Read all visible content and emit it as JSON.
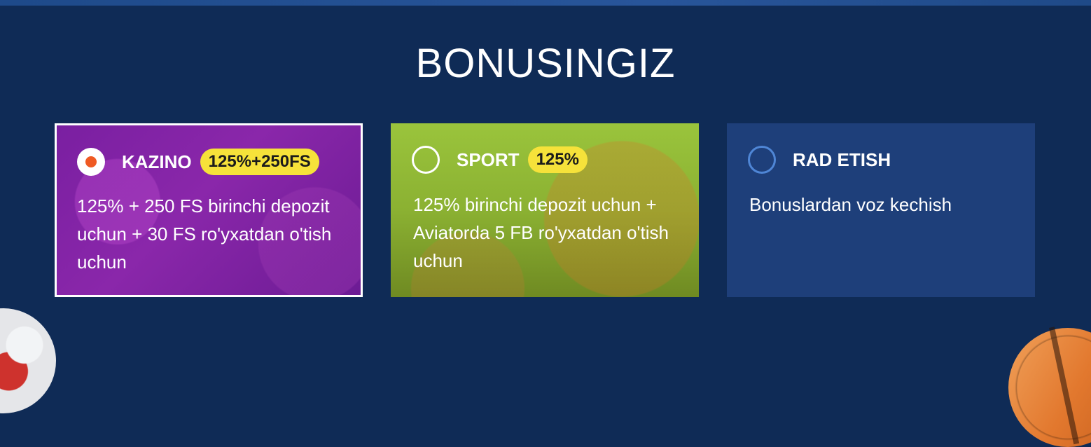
{
  "title": "BONUSINGIZ",
  "cards": [
    {
      "label": "KAZINO",
      "badge": "125%+250FS",
      "description": "125% + 250 FS birinchi depozit uchun + 30 FS ro'yxatdan o'tish uchun",
      "selected": true,
      "background_color": "#7a1fa1"
    },
    {
      "label": "SPORT",
      "badge": "125%",
      "description": "125% birinchi depozit uchun + Aviatorda 5 FB ro'yxatdan o'tish uchun",
      "selected": false,
      "background_color": "#8bb132"
    },
    {
      "label": "RAD ETISH",
      "description": "Bonuslardan voz kechish",
      "selected": false,
      "background_color": "#1e3f7a"
    }
  ],
  "colors": {
    "page_background": "#0f2b56",
    "badge": "#f6e23a",
    "radio_selected_dot": "#ef5a23",
    "radio_decline_ring": "#4f86d6"
  }
}
